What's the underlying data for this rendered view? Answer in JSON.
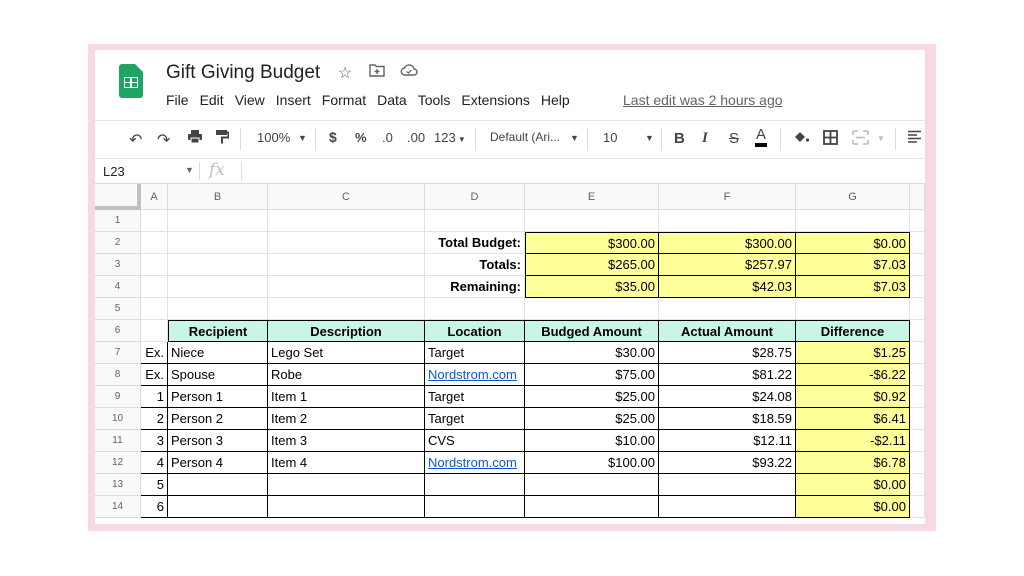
{
  "app": {
    "title": "Gift Giving Budget",
    "title_icons": [
      "star-icon",
      "move-to-folder-icon",
      "cloud-status-icon"
    ],
    "menu": [
      "File",
      "Edit",
      "View",
      "Insert",
      "Format",
      "Data",
      "Tools",
      "Extensions",
      "Help"
    ],
    "last_edit": "Last edit was 2 hours ago"
  },
  "toolbar": {
    "zoom": "100%",
    "currency": "$",
    "percent": "%",
    "decrease_decimal": ".0",
    "increase_decimal": ".00",
    "more_formats": "123",
    "font": "Default (Ari...",
    "font_size": "10",
    "bold": "B",
    "italic": "I",
    "strikethrough": "S",
    "text_color": "A"
  },
  "formula_bar": {
    "name_box": "L23",
    "fx": "fx",
    "value": ""
  },
  "columns": [
    "A",
    "B",
    "C",
    "D",
    "E",
    "F",
    "G"
  ],
  "rows": [
    "1",
    "2",
    "3",
    "4",
    "5",
    "6",
    "7",
    "8",
    "9",
    "10",
    "11",
    "12",
    "13",
    "14"
  ],
  "summary": [
    {
      "label": "Total Budget:",
      "budget": "$300.00",
      "actual": "$300.00",
      "diff": "$0.00"
    },
    {
      "label": "Totals:",
      "budget": "$265.00",
      "actual": "$257.97",
      "diff": "$7.03"
    },
    {
      "label": "Remaining:",
      "budget": "$35.00",
      "actual": "$42.03",
      "diff": "$7.03"
    }
  ],
  "table": {
    "headers": [
      "Recipient",
      "Description",
      "Location",
      "Budged Amount",
      "Actual Amount",
      "Difference"
    ],
    "rows": [
      {
        "num": "Ex.",
        "recipient": "Niece",
        "description": "Lego Set",
        "location": "Target",
        "link": false,
        "budget": "$30.00",
        "actual": "$28.75",
        "diff": "$1.25"
      },
      {
        "num": "Ex.",
        "recipient": "Spouse",
        "description": "Robe",
        "location": "Nordstrom.com",
        "link": true,
        "budget": "$75.00",
        "actual": "$81.22",
        "diff": "-$6.22"
      },
      {
        "num": "1",
        "recipient": "Person 1",
        "description": "Item 1",
        "location": "Target",
        "link": false,
        "budget": "$25.00",
        "actual": "$24.08",
        "diff": "$0.92"
      },
      {
        "num": "2",
        "recipient": "Person 2",
        "description": "Item 2",
        "location": "Target",
        "link": false,
        "budget": "$25.00",
        "actual": "$18.59",
        "diff": "$6.41"
      },
      {
        "num": "3",
        "recipient": "Person 3",
        "description": "Item 3",
        "location": "CVS",
        "link": false,
        "budget": "$10.00",
        "actual": "$12.11",
        "diff": "-$2.11"
      },
      {
        "num": "4",
        "recipient": "Person 4",
        "description": "Item 4",
        "location": "Nordstrom.com",
        "link": true,
        "budget": "$100.00",
        "actual": "$93.22",
        "diff": "$6.78"
      },
      {
        "num": "5",
        "recipient": "",
        "description": "",
        "location": "",
        "link": false,
        "budget": "",
        "actual": "",
        "diff": "$0.00"
      },
      {
        "num": "6",
        "recipient": "",
        "description": "",
        "location": "",
        "link": false,
        "budget": "",
        "actual": "",
        "diff": "$0.00"
      }
    ]
  },
  "colors": {
    "frame": "#f6d9e2",
    "header_fill": "#c9f5e6",
    "highlight_fill": "#ffff99",
    "link": "#1155cc",
    "sheets_green": "#1fa463"
  }
}
